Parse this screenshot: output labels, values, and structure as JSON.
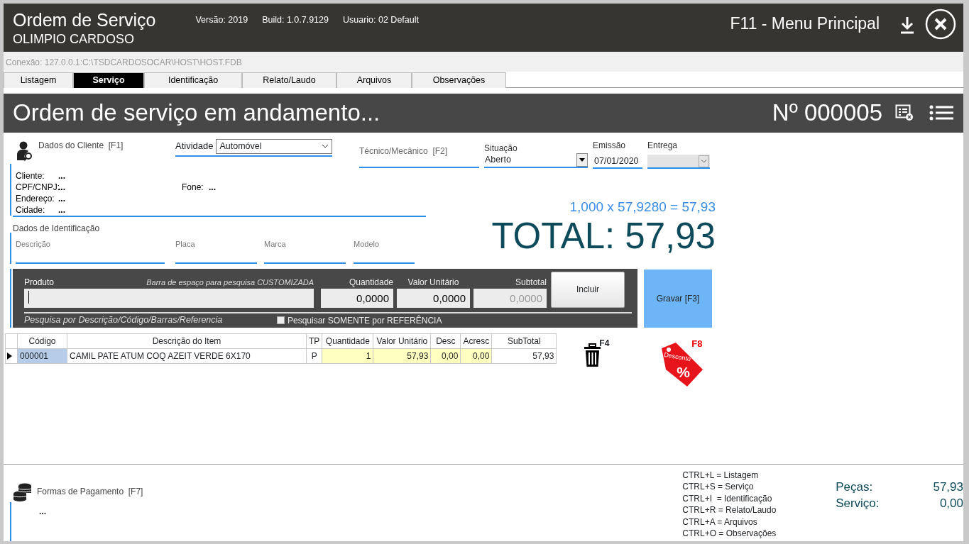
{
  "header": {
    "title": "Ordem de Serviço",
    "subtitle": "OLIMPIO CARDOSO",
    "info": [
      "Versão: 2019",
      "Build: 1.0.7.9129",
      "Usuario: 02 Default"
    ],
    "menu": "F11 - Menu Principal"
  },
  "connection": "Conexão: 127.0.0.1:C:\\TSDCARDOSOCAR\\HOST\\HOST.FDB",
  "tabs": [
    {
      "label": "Listagem",
      "selected": false
    },
    {
      "label": "Serviço",
      "selected": true
    },
    {
      "label": "Identificação",
      "selected": false
    },
    {
      "label": "Relato/Laudo",
      "selected": false
    },
    {
      "label": "Arquivos",
      "selected": false
    },
    {
      "label": "Observações",
      "selected": false
    }
  ],
  "status_title": "Ordem de serviço em andamento...",
  "order_number": "Nº 000005",
  "client": {
    "title": "Dados do Cliente",
    "shortcut": "[F1]",
    "rows": [
      [
        {
          "label": "Cliente:",
          "value": "..."
        }
      ],
      [
        {
          "label": "CPF/CNPJ:",
          "value": "..."
        },
        {
          "label": "Fone:",
          "value": "..."
        }
      ],
      [
        {
          "label": "Endereço:",
          "value": "..."
        }
      ],
      [
        {
          "label": "Cidade:",
          "value": "..."
        }
      ]
    ]
  },
  "activity": {
    "label": "Atividade",
    "value": "Automóvel"
  },
  "technician": {
    "label": "Técnico/Mecânico",
    "shortcut": "[F2]"
  },
  "situation": {
    "label": "Situação",
    "value": "Aberto"
  },
  "emission": {
    "label": "Emissão",
    "value": "07/01/2020"
  },
  "delivery": {
    "label": "Entrega",
    "disabled": true
  },
  "identification": {
    "title": "Dados de Identificação",
    "fields": [
      "Descrição",
      "Placa",
      "Marca",
      "Modelo"
    ]
  },
  "calc": "1,000 x 57,9280 = 57,93",
  "total": "TOTAL: 57,93",
  "product": {
    "label": "Produto",
    "hint": "Barra de espaço para pesquisa CUSTOMIZADA",
    "quantity": {
      "label": "Quantidade",
      "value": "0,0000"
    },
    "unit_price": {
      "label": "Valor Unitário",
      "value": "0,0000"
    },
    "subtotal": {
      "label": "Subtotal",
      "value": "0,0000",
      "disabled": true
    },
    "add_button": "Incluir",
    "search_note": "Pesquisa por Descrição/Código/Barras/Referencia",
    "ref_only": {
      "label": "Pesquisar SOMENTE por REFERÊNCIA",
      "checked": false
    }
  },
  "save_button": "Gravar [F3]",
  "table": {
    "columns": [
      {
        "label": "Código",
        "kind": "text"
      },
      {
        "label": "Descrição do Item",
        "kind": "text"
      },
      {
        "label": "TP",
        "kind": "center"
      },
      {
        "label": "Quantidade",
        "kind": "editable"
      },
      {
        "label": "Valor Unitário",
        "kind": "editable"
      },
      {
        "label": "Desc",
        "kind": "editable"
      },
      {
        "label": "Acresc",
        "kind": "editable"
      },
      {
        "label": "SubTotal",
        "kind": "number"
      }
    ],
    "rows": [
      {
        "selected": true,
        "cells": [
          "000001",
          "CAMIL PATE ATUM COQ AZEIT VERDE 6X170",
          "P",
          "1",
          "57,93",
          "0,00",
          "0,00",
          "57,93"
        ]
      }
    ]
  },
  "delete_shortcut": "F4",
  "discount": {
    "shortcut": "F8",
    "label": "Desconto",
    "symbol": "%"
  },
  "payment": {
    "title": "Formas de Pagamento",
    "shortcut": "[F7]",
    "value": "..."
  },
  "shortcuts": [
    "CTRL+L = Listagem",
    "CTRL+S = Serviço",
    "CTRL+I  = Identificação",
    "CTRL+R = Relato/Laudo",
    "CTRL+A = Arquivos",
    "CTRL+O = Observações"
  ],
  "totals": [
    {
      "label": "Peças:",
      "value": "57,93"
    },
    {
      "label": "Serviço:",
      "value": "0,00"
    }
  ]
}
